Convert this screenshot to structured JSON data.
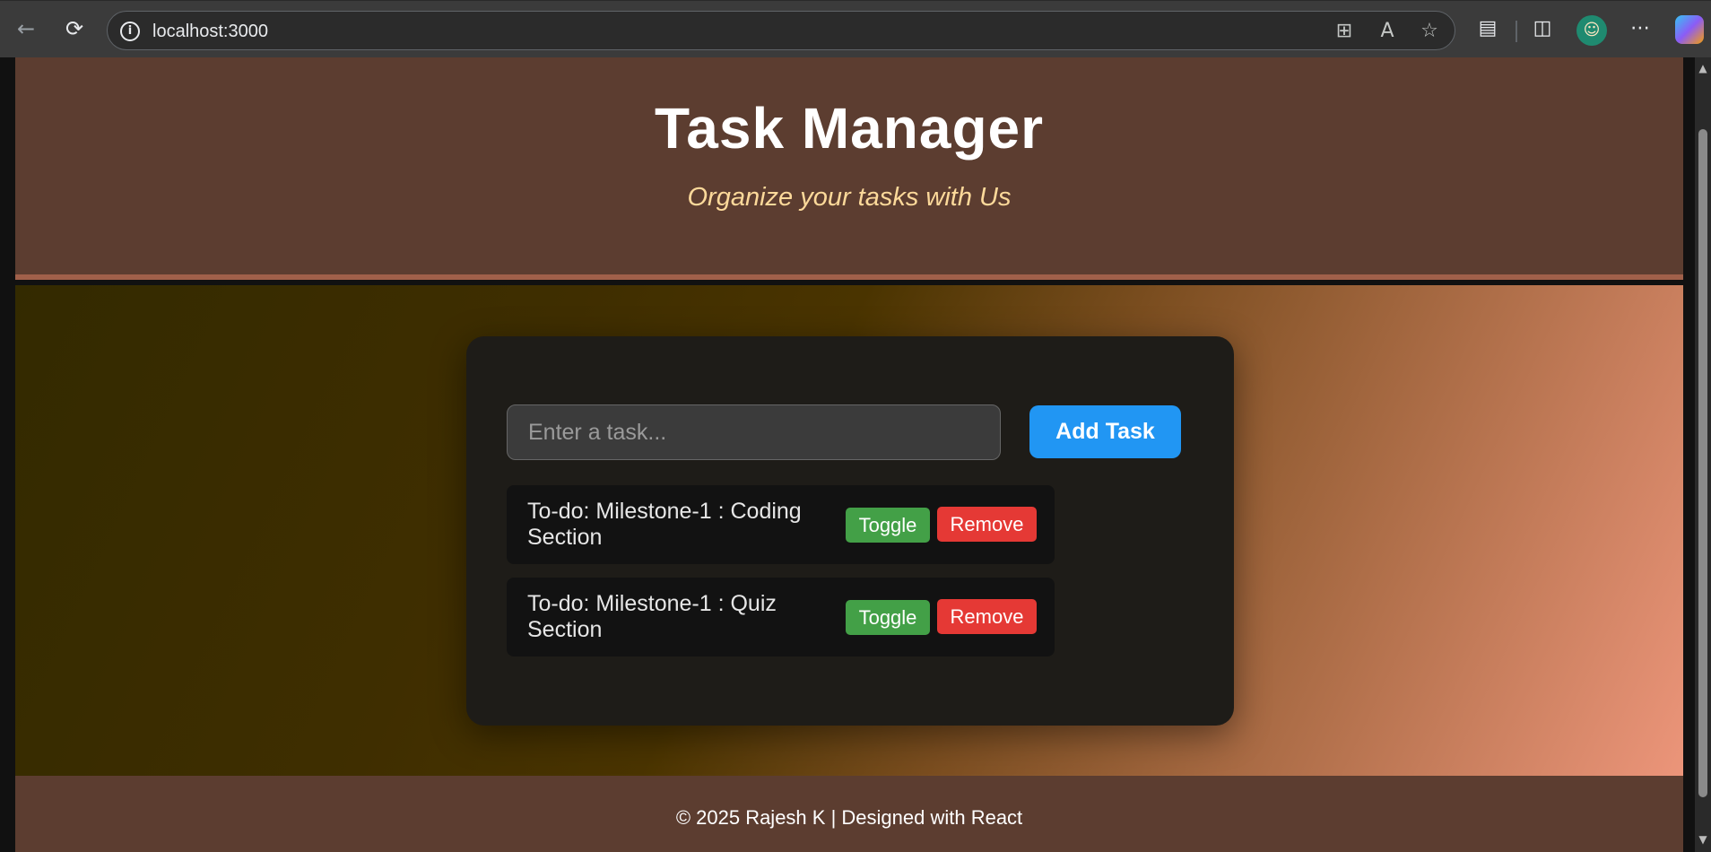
{
  "browser": {
    "url": "localhost:3000",
    "icons": {
      "back": "back-arrow-icon",
      "reload": "reload-icon",
      "info": "info-icon",
      "apps": "app-grid-icon",
      "read_aloud": "read-aloud-icon",
      "favorite": "star-icon",
      "extension": "extension-icon",
      "split": "split-screen-icon",
      "profile": "avatar",
      "more": "more-icon",
      "copilot": "copilot-icon"
    }
  },
  "header": {
    "title": "Task Manager",
    "subtitle": "Organize your tasks with Us"
  },
  "form": {
    "placeholder": "Enter a task...",
    "value": "",
    "add_label": "Add Task"
  },
  "tasks": [
    {
      "text": "To-do: Milestone-1 : Coding Section",
      "toggle_label": "Toggle",
      "remove_label": "Remove"
    },
    {
      "text": "To-do: Milestone-1 : Quiz Section",
      "toggle_label": "Toggle",
      "remove_label": "Remove"
    }
  ],
  "footer": {
    "text": "© 2025 Rajesh K | Designed with React"
  },
  "colors": {
    "header_bg": "#5c3d30",
    "accent": "#2196f3",
    "toggle": "#43a047",
    "remove": "#e53935",
    "subtitle": "#fcd99a"
  }
}
